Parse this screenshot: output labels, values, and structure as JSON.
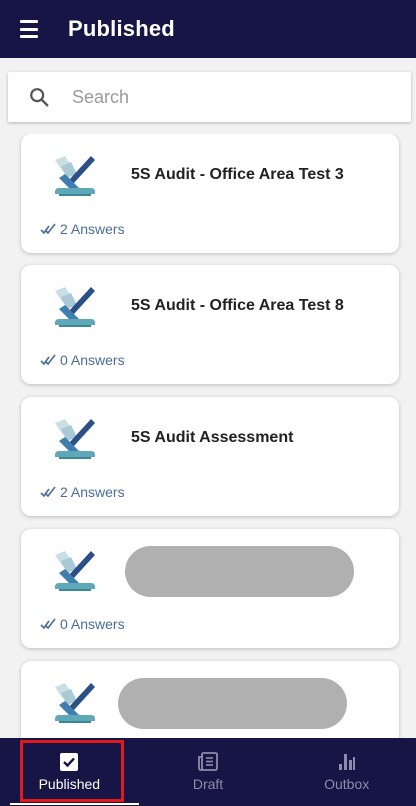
{
  "header": {
    "title": "Published",
    "menu_icon": "hamburger-menu-icon"
  },
  "search": {
    "placeholder": "Search",
    "value": "",
    "icon": "search-icon"
  },
  "cards": [
    {
      "title": "5S Audit - Office Area Test 3",
      "answers": "2 Answers",
      "title_redacted": false
    },
    {
      "title": "5S Audit - Office Area Test 8",
      "answers": "0 Answers",
      "title_redacted": false
    },
    {
      "title": "5S Audit Assessment",
      "answers": "2 Answers",
      "title_redacted": false
    },
    {
      "title": "",
      "answers": "0 Answers",
      "title_redacted": true
    },
    {
      "title": "",
      "answers": "",
      "title_redacted": true
    }
  ],
  "bottom_nav": {
    "items": [
      {
        "label": "Published",
        "icon": "checkbox-icon",
        "active": true
      },
      {
        "label": "Draft",
        "icon": "draft-document-icon",
        "active": false
      },
      {
        "label": "Outbox",
        "icon": "bar-chart-icon",
        "active": false
      }
    ]
  },
  "colors": {
    "app_bar": "#171446",
    "answers_text": "#4a6c9a",
    "highlight": "#e01b1b"
  }
}
